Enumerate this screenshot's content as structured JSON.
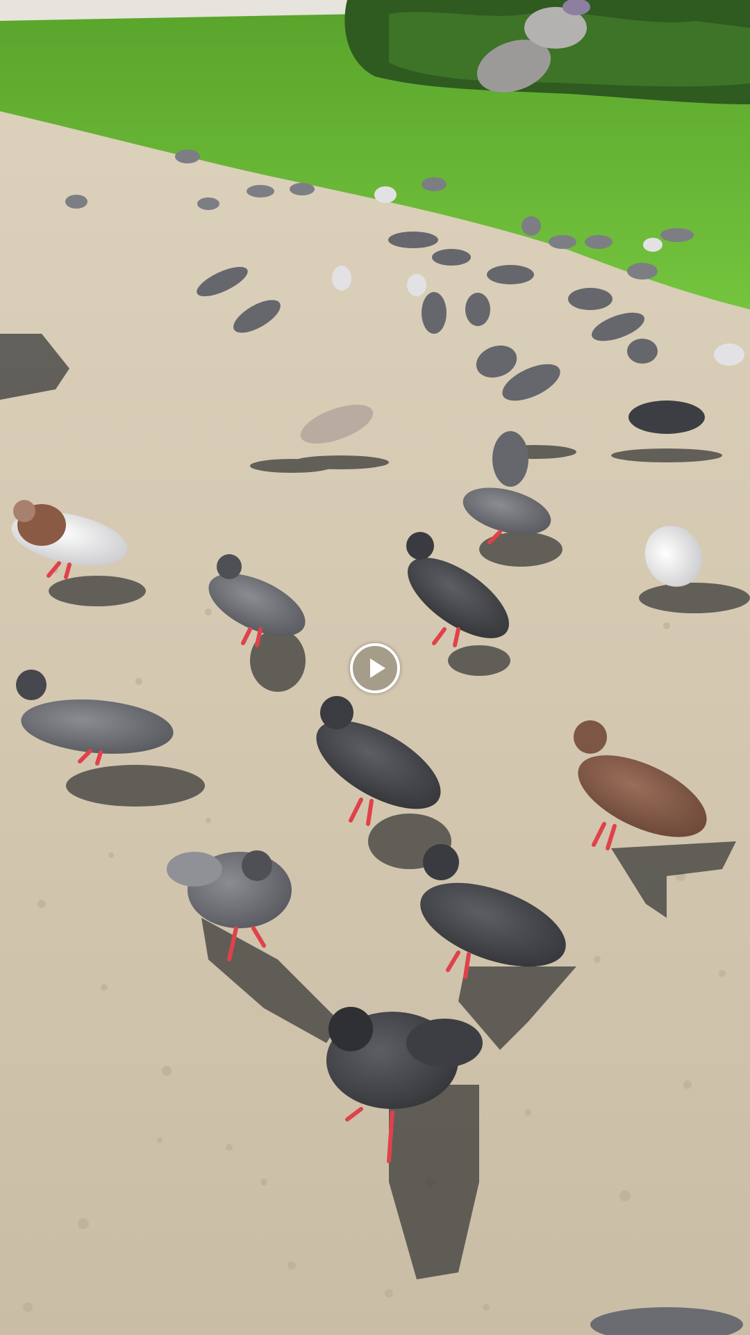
{
  "video_player": {
    "play_button_label": "",
    "state": "paused",
    "icon": "play-icon"
  },
  "scene": {
    "description_colors": {
      "grass": "#6fbf3a",
      "path": "#d2c6b0",
      "shadow": "#3b3b3b",
      "hedge": "#2f5a20"
    }
  }
}
